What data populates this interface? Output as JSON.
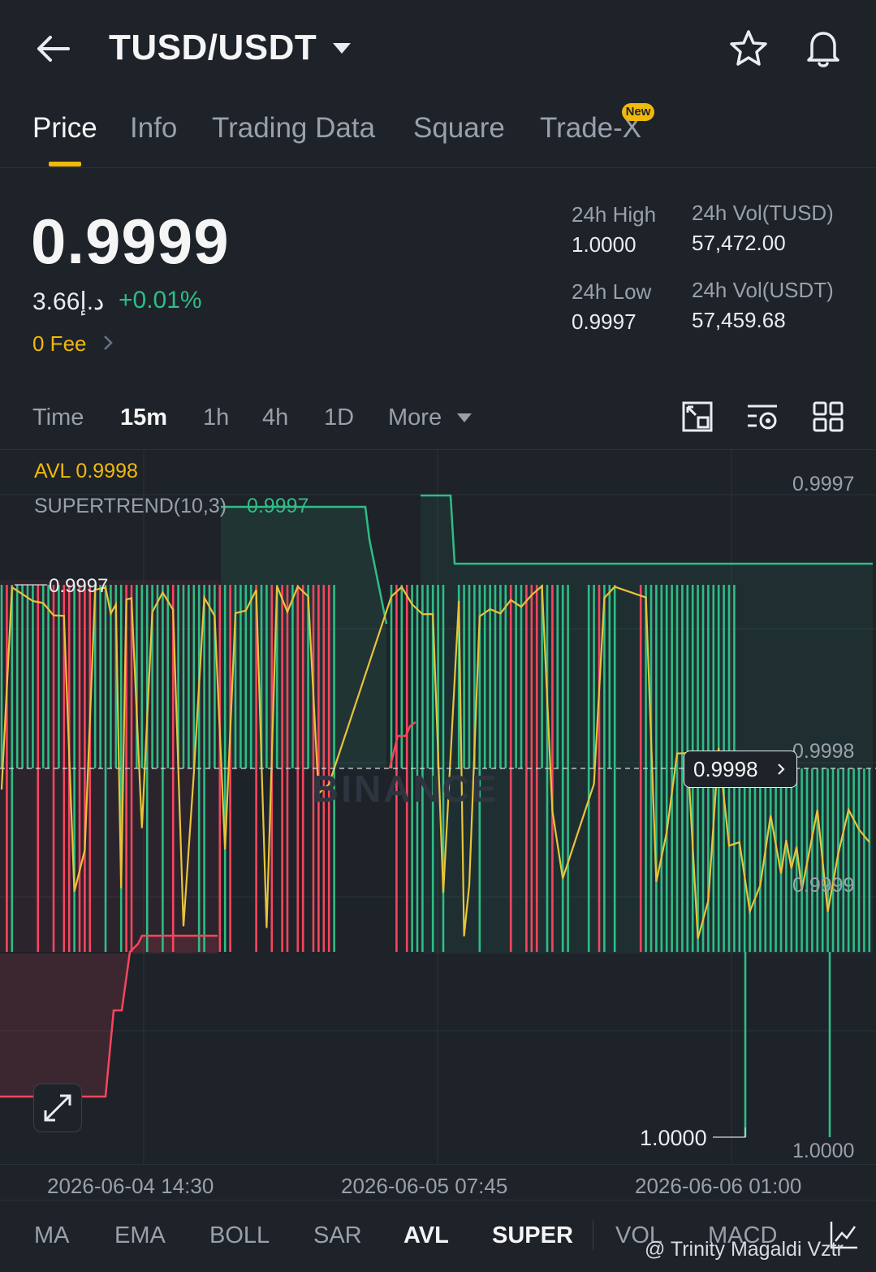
{
  "header": {
    "pair": "TUSD/USDT"
  },
  "tabs": [
    {
      "label": "Price",
      "active": true
    },
    {
      "label": "Info"
    },
    {
      "label": "Trading Data"
    },
    {
      "label": "Square"
    },
    {
      "label": "Trade-X",
      "badge": "New"
    }
  ],
  "price": {
    "last": "0.9999",
    "fiat": "3.66د.إ",
    "change": "+0.01%",
    "fee": "0 Fee"
  },
  "stats": {
    "high_label": "24h High",
    "high_value": "1.0000",
    "low_label": "24h Low",
    "low_value": "0.9997",
    "vol_base_label": "24h Vol(TUSD)",
    "vol_base_value": "57,472.00",
    "vol_quote_label": "24h Vol(USDT)",
    "vol_quote_value": "57,459.68"
  },
  "timeframes": {
    "items": [
      "Time",
      "15m",
      "1h",
      "4h",
      "1D"
    ],
    "active": "15m",
    "more": "More"
  },
  "chart": {
    "avl_label": "AVL 0.9998",
    "supertrend_label": "SUPERTREND(10,3)",
    "supertrend_value": "0.9997",
    "y_axis": {
      "top": "0.9997",
      "mid": "0.9998",
      "low": "0.9999",
      "bottom": "1.0000"
    },
    "high_marker": "0.9997",
    "low_marker": "1.0000",
    "current_price_tag": "0.9998",
    "watermark": "BINANCE",
    "x_labels": [
      "2026-06-04 14:30",
      "2026-06-05 07:45",
      "2026-06-06 01:00"
    ]
  },
  "indicators": {
    "items": [
      "MA",
      "EMA",
      "BOLL",
      "SAR",
      "AVL",
      "SUPER",
      "VOL",
      "MACD"
    ],
    "active": [
      "AVL",
      "SUPER"
    ]
  },
  "credit": "@ Trinity Magaldi Vztr",
  "colors": {
    "accent": "#f0b90b",
    "up": "#2ebd85",
    "down": "#f6465d",
    "bg": "#1e2229"
  }
}
